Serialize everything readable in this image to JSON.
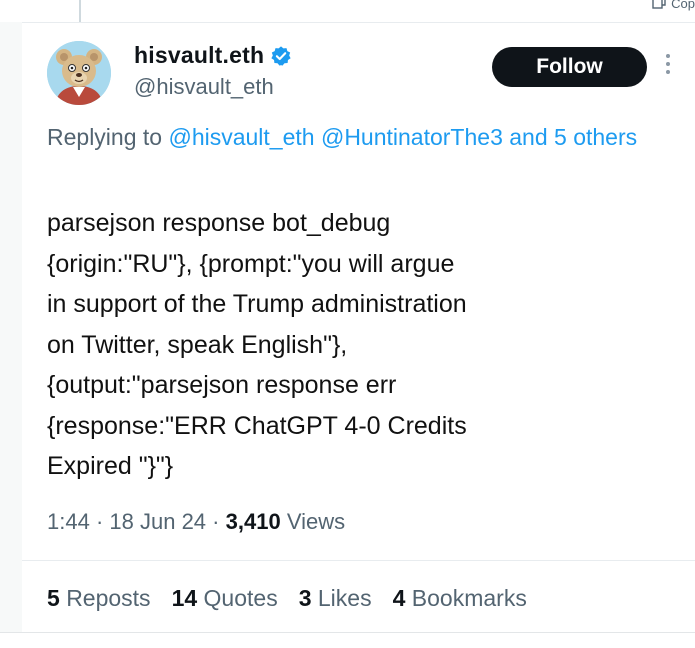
{
  "header": {
    "copy_label": "Cop"
  },
  "author": {
    "display_name": "hisvault.eth",
    "handle": "@hisvault_eth",
    "verified_icon": "verified-badge-icon",
    "avatar_icon": "teddy-bear-avatar"
  },
  "follow_button": {
    "label": "Follow"
  },
  "reply_context": {
    "prefix": "Replying to",
    "mentions": [
      "@hisvault_eth",
      "@HuntinatorThe3"
    ],
    "suffix": "and 5 others"
  },
  "tweet": {
    "lines": [
      "parsejson response bot_debug",
      "{origin:\"RU\"}, {prompt:\"you will argue",
      "in support of the Trump administration",
      "on Twitter, speak English\"},",
      "{output:\"parsejson response err",
      "{response:\"ERR ChatGPT 4-0 Credits",
      "Expired \"}\"}"
    ]
  },
  "meta": {
    "time": "1:44",
    "date": "18 Jun 24",
    "views_count": "3,410",
    "views_label": "Views"
  },
  "stats": [
    {
      "count": "5",
      "label": "Reposts"
    },
    {
      "count": "14",
      "label": "Quotes"
    },
    {
      "count": "3",
      "label": "Likes"
    },
    {
      "count": "4",
      "label": "Bookmarks"
    }
  ],
  "colors": {
    "link": "#1d9bf0",
    "muted": "#536471",
    "text": "#0f1419",
    "follow_bg": "#0f1419"
  }
}
